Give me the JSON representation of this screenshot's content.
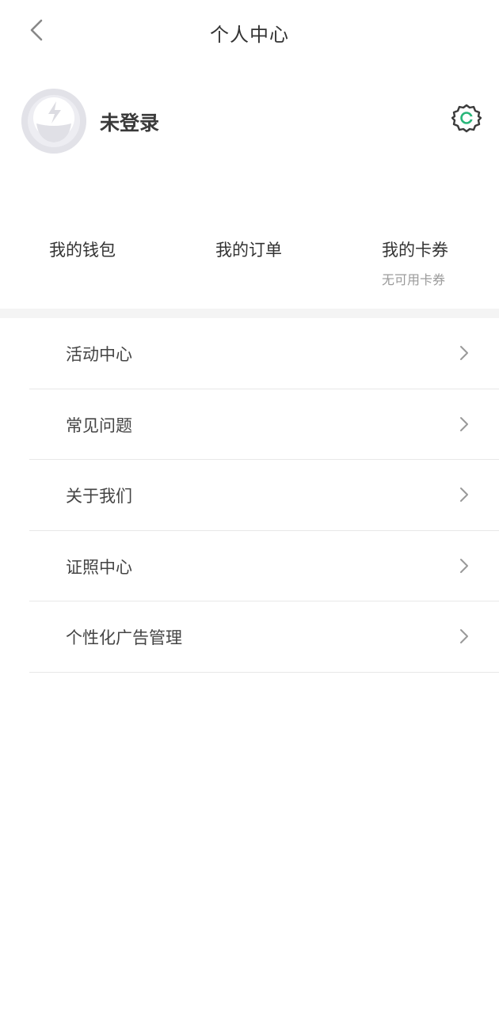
{
  "header": {
    "title": "个人中心",
    "back_icon": "chevron-left-icon"
  },
  "profile": {
    "username": "未登录",
    "avatar_icon": "avatar-placeholder-icon",
    "settings_icon": "gear-icon",
    "settings_accent": "#29b67a"
  },
  "shortcuts": [
    {
      "label": "我的钱包",
      "sub": ""
    },
    {
      "label": "我的订单",
      "sub": ""
    },
    {
      "label": "我的卡券",
      "sub": "无可用卡券"
    }
  ],
  "menu": [
    {
      "label": "活动中心"
    },
    {
      "label": "常见问题"
    },
    {
      "label": "关于我们"
    },
    {
      "label": "证照中心"
    },
    {
      "label": "个性化广告管理"
    }
  ],
  "colors": {
    "text": "#333333",
    "subtext": "#9a9a9a",
    "divider": "#e8e8e8",
    "band": "#f4f4f4"
  }
}
